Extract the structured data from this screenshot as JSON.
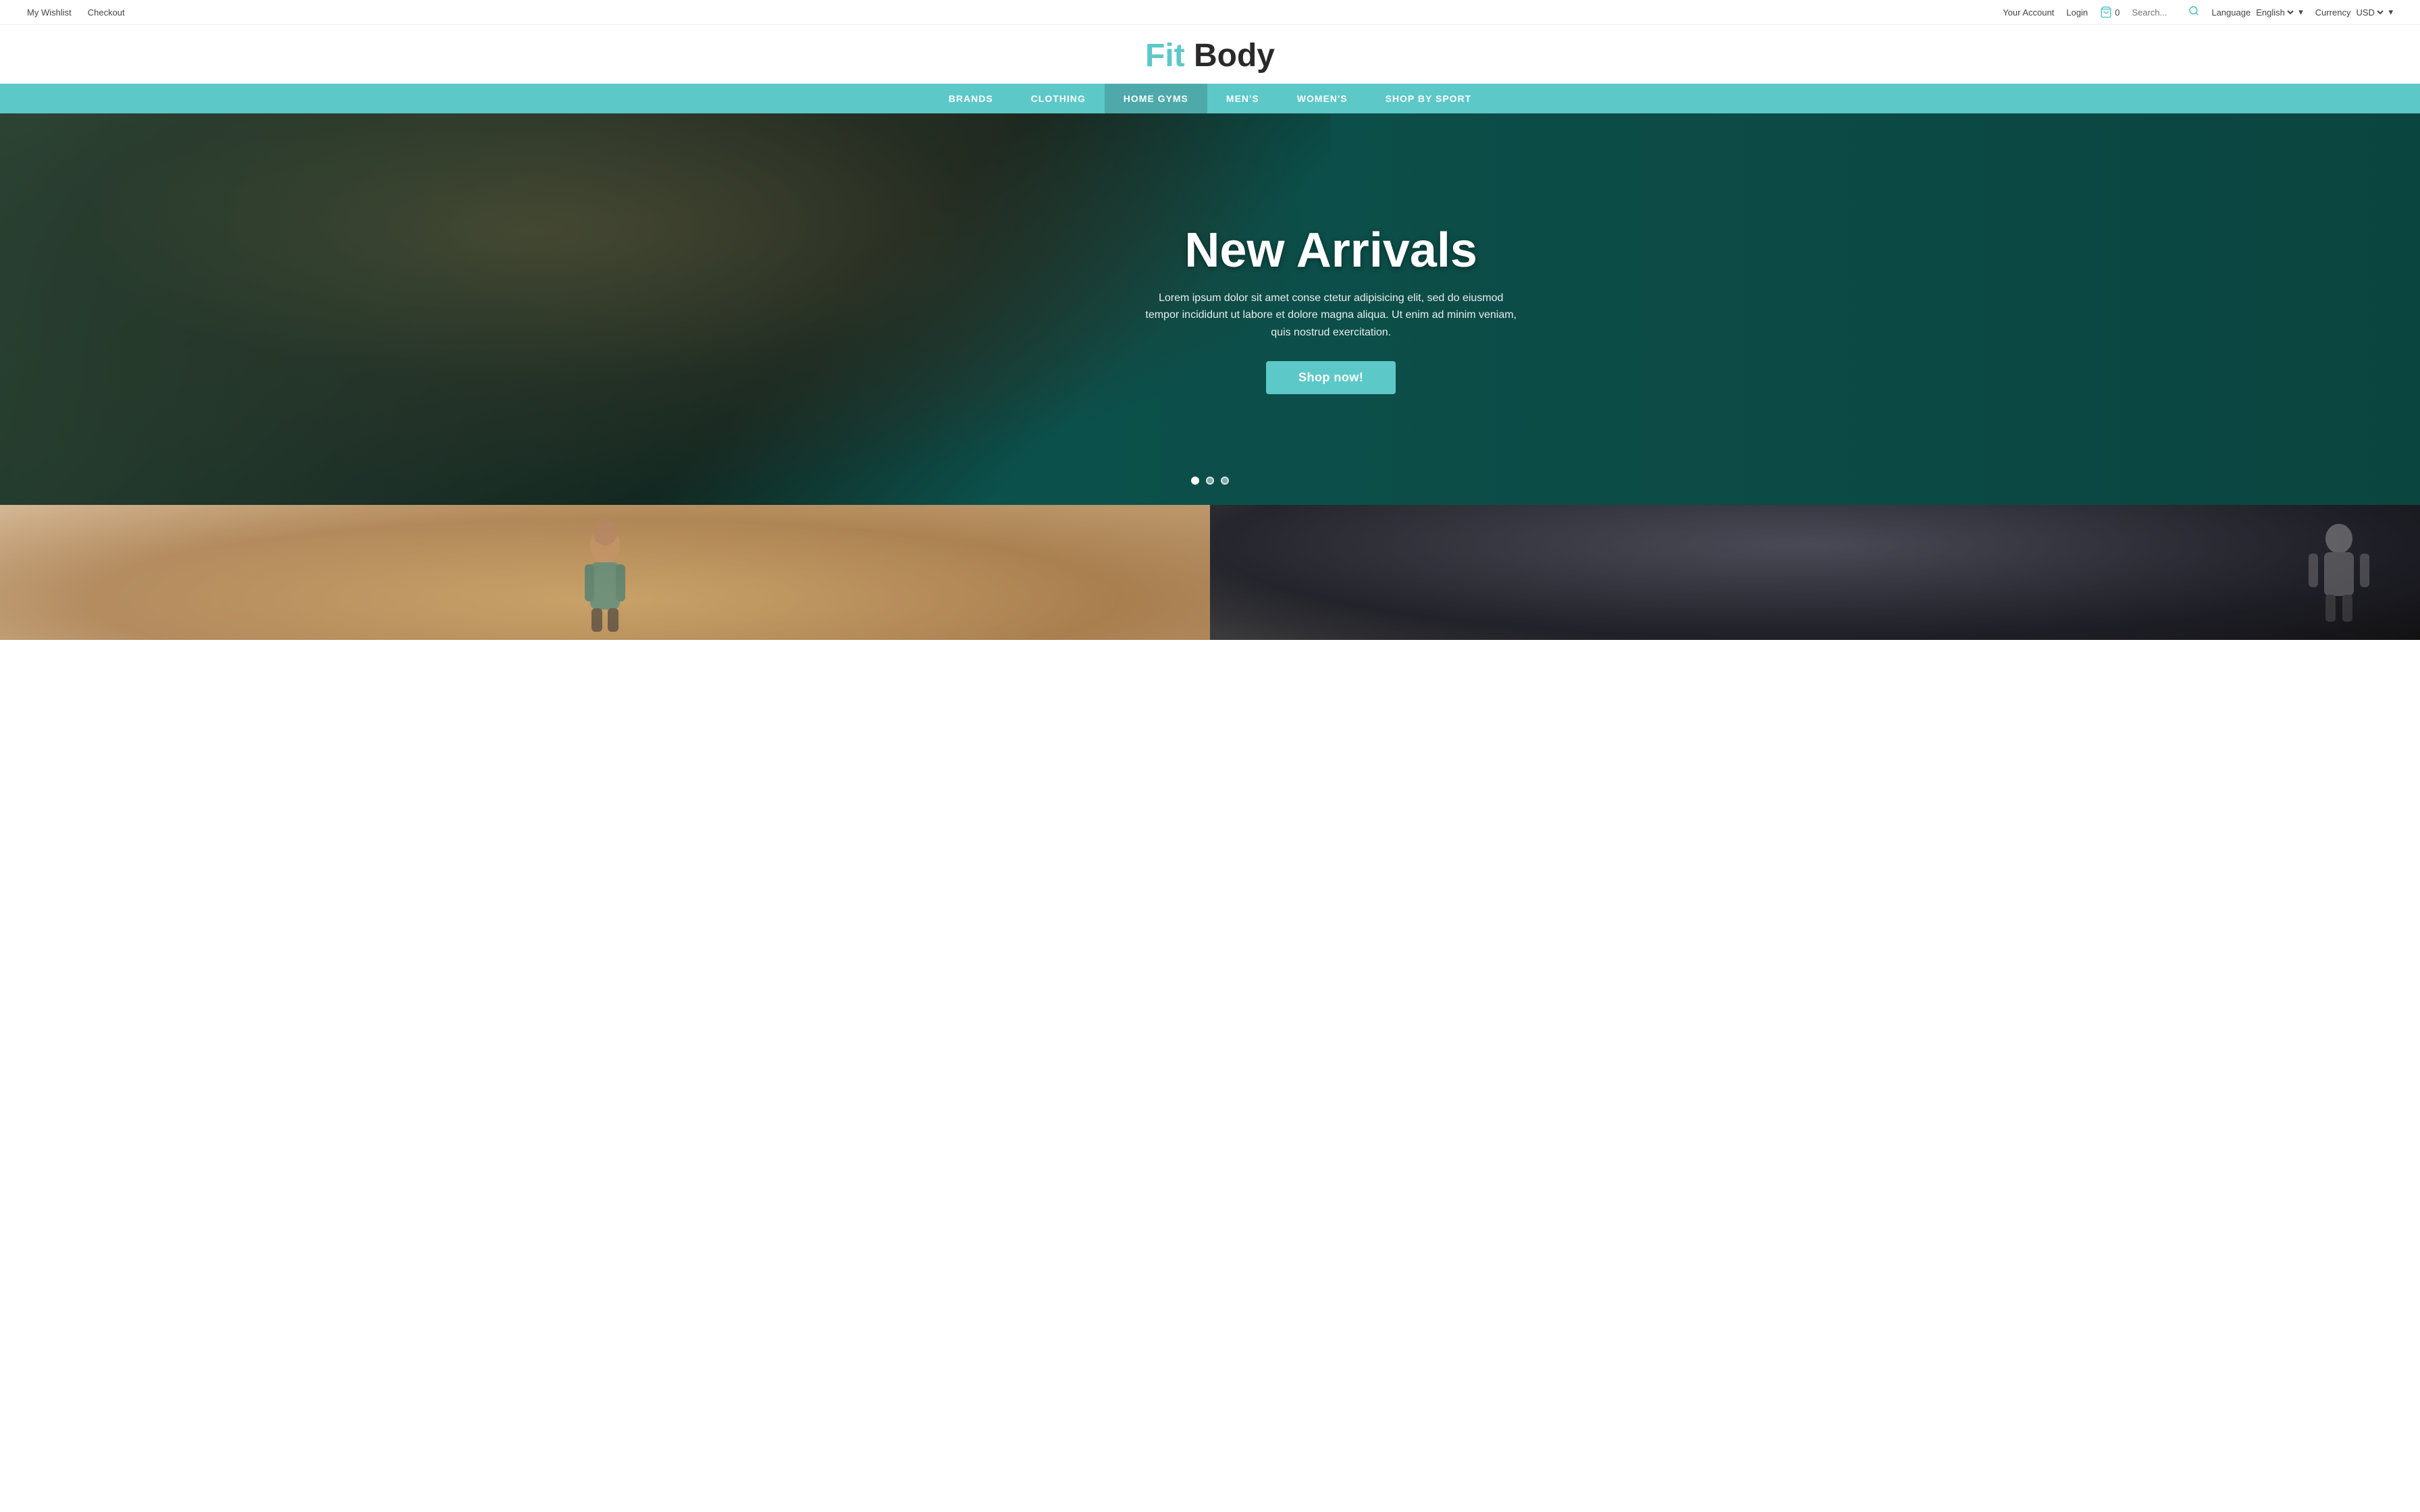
{
  "topbar": {
    "left": {
      "wishlist": "My Wishlist",
      "checkout": "Checkout"
    },
    "right": {
      "account": "Your Account",
      "login": "Login",
      "cart_count": "0",
      "search_placeholder": "Search...",
      "language_label": "Language",
      "language_value": "English",
      "currency_label": "Currency",
      "currency_value": "USD"
    }
  },
  "logo": {
    "fit": "Fit",
    "body": " Body"
  },
  "nav": {
    "items": [
      {
        "label": "BRANDS",
        "active": false
      },
      {
        "label": "CLOTHING",
        "active": false
      },
      {
        "label": "HOME GYMS",
        "active": true
      },
      {
        "label": "MEN'S",
        "active": false
      },
      {
        "label": "WOMEN'S",
        "active": false
      },
      {
        "label": "SHOP BY SPORT",
        "active": false
      }
    ]
  },
  "hero": {
    "title": "New Arrivals",
    "subtitle": "Lorem ipsum dolor sit amet conse ctetur adipisicing elit, sed do eiusmod tempor incididunt ut labore et dolore magna aliqua. Ut enim ad minim veniam, quis nostrud exercitation.",
    "cta_label": "Shop now!",
    "dots": [
      {
        "active": true
      },
      {
        "active": false
      },
      {
        "active": false
      }
    ]
  },
  "footer_preview": {
    "left_alt": "Woman in athletic wear",
    "right_alt": "Man in gym"
  },
  "colors": {
    "teal": "#5cc8c8",
    "dark": "#2a2a2a"
  }
}
